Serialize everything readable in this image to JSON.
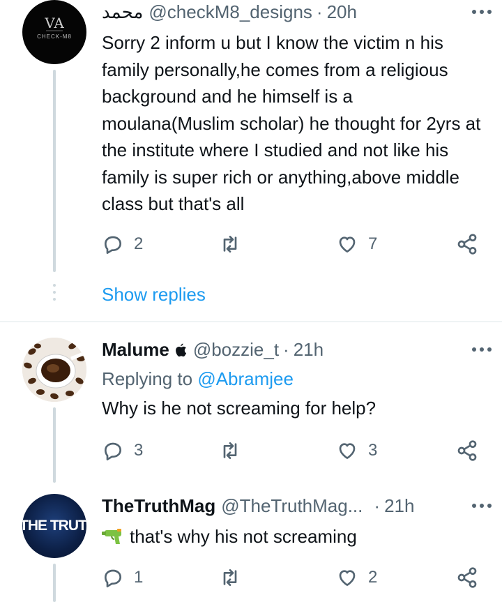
{
  "tweets": [
    {
      "name": "محمد",
      "handle": "@checkM8_designs",
      "time": "20h",
      "text": "Sorry 2 inform u but I know the victim n his family personally,he comes from a religious background and he himself is a moulana(Muslim scholar) he thought for 2yrs at the institute where I studied and not like his family is super rich or anything,above middle class but that's all",
      "avatar_text": "CHECK-M8",
      "replies": "2",
      "retweets": "",
      "likes": "7",
      "show_replies": "Show replies"
    },
    {
      "name": "Malume",
      "handle": "@bozzie_t",
      "time": "21h",
      "replying_label": "Replying to",
      "replying_to": "@Abramjee",
      "text": "Why is he not screaming for help?",
      "replies": "3",
      "retweets": "",
      "likes": "3"
    },
    {
      "name": "TheTruthMag",
      "handle": "@TheTruthMag...",
      "time": "21h",
      "text": "that's why his not screaming",
      "avatar_text": "THE TRUTH",
      "replies": "1",
      "retweets": "",
      "likes": "2"
    }
  ],
  "separator": "·",
  "colors": {
    "text": "#0f1419",
    "secondary": "#536471",
    "link": "#1d9bf0",
    "line": "#cfd9de"
  },
  "icons": [
    "more-icon",
    "reply-icon",
    "retweet-icon",
    "like-icon",
    "share-icon",
    "apple-icon",
    "water-gun-icon"
  ]
}
